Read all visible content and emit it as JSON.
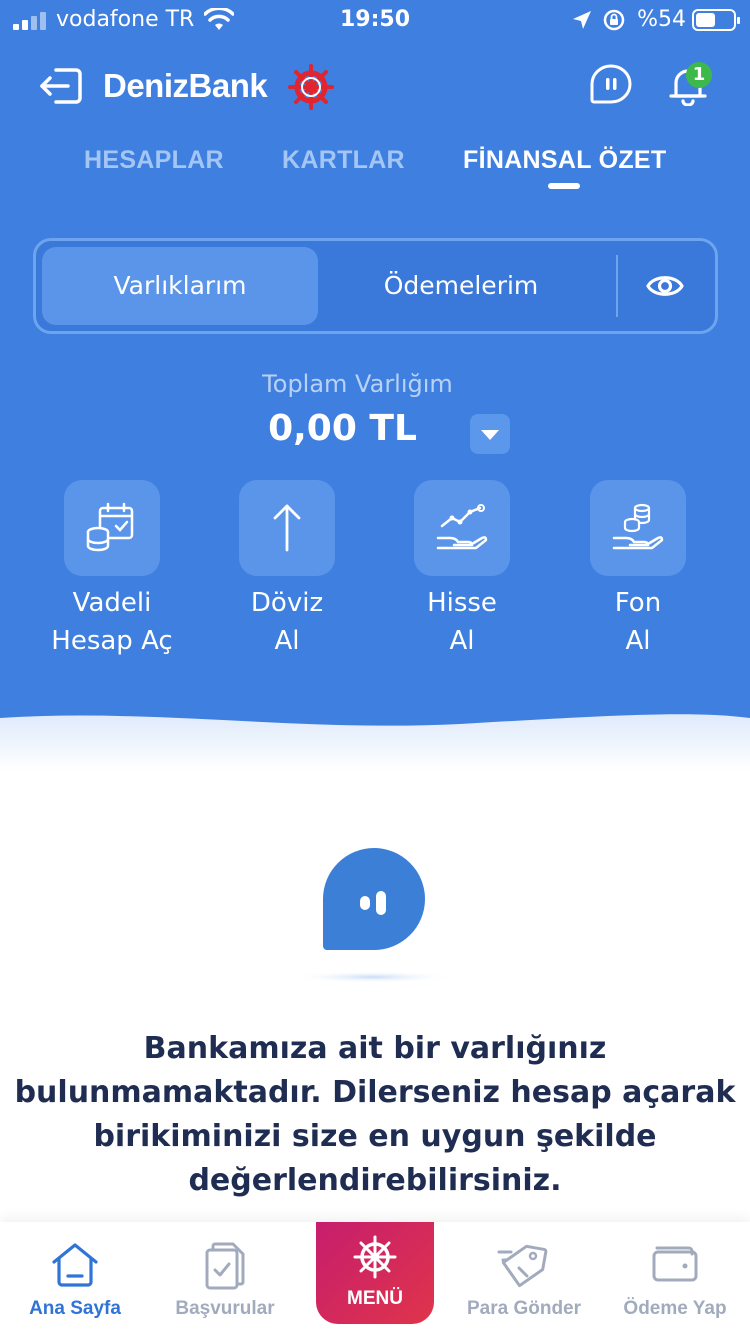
{
  "status_bar": {
    "carrier": "vodafone TR",
    "time": "19:50",
    "battery": "%54",
    "battery_level": 0.54
  },
  "header": {
    "logo": "DenizBank",
    "notification_count": "1"
  },
  "tabs": [
    {
      "label": "HESAPLAR",
      "active": false
    },
    {
      "label": "KARTLAR",
      "active": false
    },
    {
      "label": "FİNANSAL ÖZET",
      "active": true
    }
  ],
  "segment": {
    "assets": "Varlıklarım",
    "payments": "Ödemelerim"
  },
  "summary": {
    "label": "Toplam Varlığım",
    "value": "0,00 TL"
  },
  "actions": [
    {
      "line1": "Vadeli",
      "line2": "Hesap Aç",
      "icon": "calendar-coins-icon"
    },
    {
      "line1": "Döviz",
      "line2": "Al",
      "icon": "arrow-up-icon"
    },
    {
      "line1": "Hisse",
      "line2": "Al",
      "icon": "stock-hand-icon"
    },
    {
      "line1": "Fon",
      "line2": "Al",
      "icon": "coins-hand-icon"
    }
  ],
  "empty_state": {
    "line1": "Bankamıza ait bir varlığınız",
    "line2": "bulunmamaktadır. Dilerseniz hesap açarak",
    "line3": "birikiminizi size en uygun şekilde",
    "line4": "değerlendirebilirsiniz."
  },
  "bottom_nav": {
    "home": "Ana Sayfa",
    "applications": "Başvurular",
    "menu": "MENÜ",
    "send_money": "Para Gönder",
    "pay": "Ödeme Yap"
  },
  "colors": {
    "primary_blue": "#3f7fe0",
    "menu_gradient_start": "#c61e6e",
    "menu_gradient_end": "#e0344a",
    "badge_green": "#3db94c",
    "text_dark": "#1f2d52"
  }
}
